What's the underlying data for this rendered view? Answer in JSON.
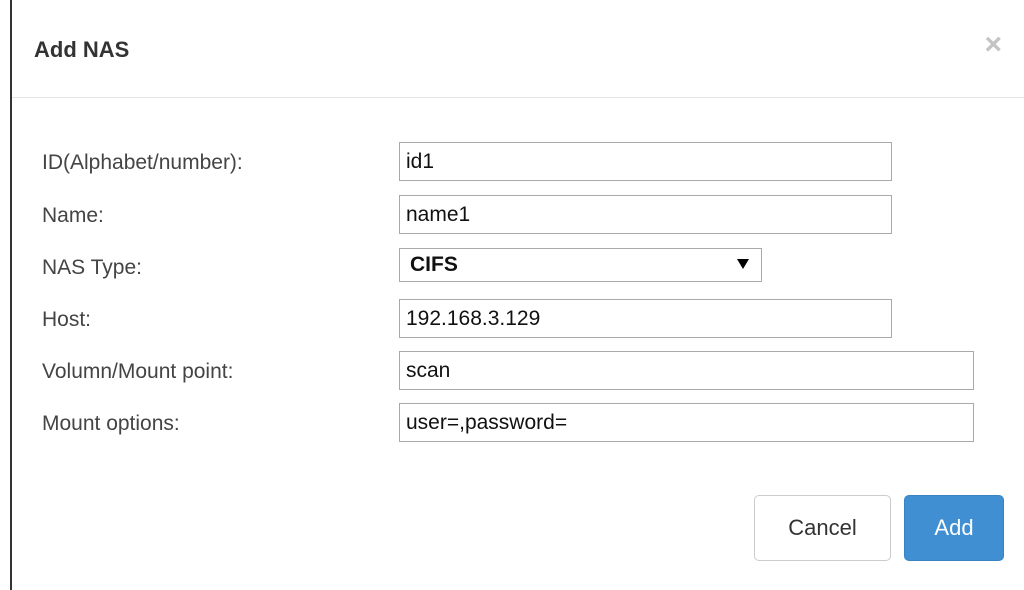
{
  "dialog": {
    "title": "Add NAS",
    "close_symbol": "×"
  },
  "form": {
    "id_field": {
      "label": "ID(Alphabet/number):",
      "value": "id1"
    },
    "name_field": {
      "label": "Name:",
      "value": "name1"
    },
    "nas_type_field": {
      "label": "NAS Type:",
      "selected": "CIFS",
      "arrow_icon": "dropdown-arrow-icon"
    },
    "host_field": {
      "label": "Host:",
      "value": "192.168.3.129"
    },
    "volume_field": {
      "label": "Volumn/Mount point:",
      "value": "scan"
    },
    "mount_options_field": {
      "label": "Mount options:",
      "value": "user=,password="
    }
  },
  "footer": {
    "cancel_label": "Cancel",
    "add_label": "Add"
  },
  "colors": {
    "primary": "#3f8fd2",
    "close_icon": "#c4c4c4"
  }
}
